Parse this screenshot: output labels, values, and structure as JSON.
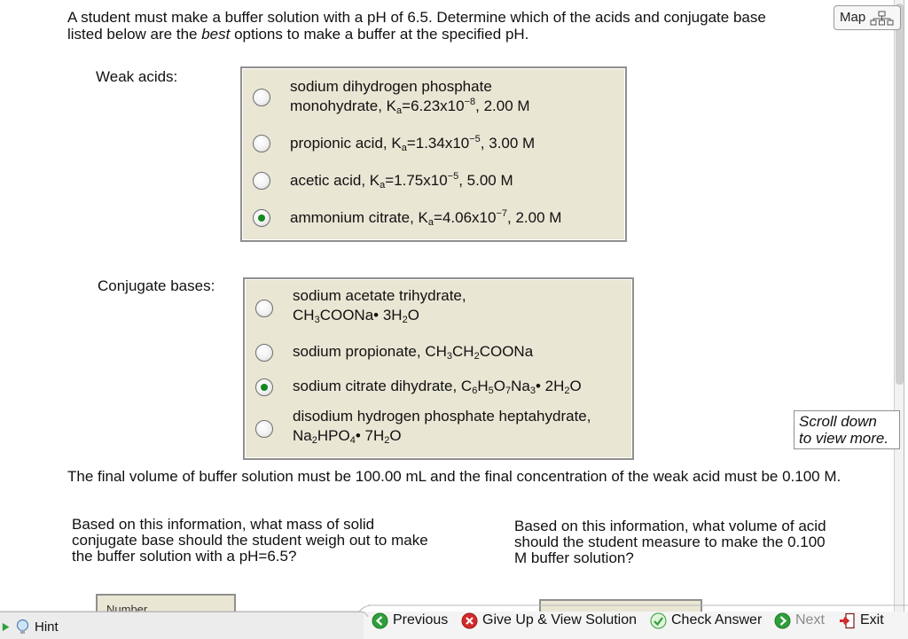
{
  "question": {
    "intro_part1": "A student must make a buffer solution with a pH of 6.5. Determine which of the acids and conjugate base",
    "intro_part2": "listed below are the ",
    "intro_emphasis": "best",
    "intro_part3": " options to make a buffer at the specified pH."
  },
  "map_button": {
    "label": "Map",
    "icon": "map-network-icon"
  },
  "weak_acids": {
    "label": "Weak acids:",
    "options": [
      {
        "line1": "sodium dihydrogen phosphate",
        "line2_pre": "monohydrate, K",
        "sub": "a",
        "eq": "=6.23x10",
        "sup": "−8",
        "post": ", 2.00 M",
        "selected": false
      },
      {
        "pre": "propionic acid, K",
        "sub": "a",
        "eq": "=1.34x10",
        "sup": "−5",
        "post": ", 3.00 M",
        "selected": false
      },
      {
        "pre": "acetic acid, K",
        "sub": "a",
        "eq": "=1.75x10",
        "sup": "−5",
        "post": ", 5.00 M",
        "selected": false
      },
      {
        "pre": "ammonium citrate, K",
        "sub": "a",
        "eq": "=4.06x10",
        "sup": "−7",
        "post": ", 2.00 M",
        "selected": true
      }
    ]
  },
  "conjugate_bases": {
    "label": "Conjugate bases:",
    "options": [
      {
        "line1": "sodium acetate trihydrate,",
        "f": [
          "CH",
          "3",
          "COONa• 3H",
          "2",
          "O"
        ],
        "selected": false
      },
      {
        "f": [
          "sodium propionate, CH",
          "3",
          "CH",
          "2",
          "COONa"
        ],
        "selected": false
      },
      {
        "f": [
          "sodium citrate dihydrate, C",
          "6",
          "H",
          "5",
          "O",
          "7",
          "Na",
          "3",
          "• 2H",
          "2",
          "O"
        ],
        "selected": true
      },
      {
        "line1": "disodium hydrogen phosphate heptahydrate,",
        "f": [
          "Na",
          "2",
          "HPO",
          "4",
          "• 7H",
          "2",
          "O"
        ],
        "selected": false
      }
    ]
  },
  "scroll_note": {
    "line1": "Scroll down",
    "line2": "to view more."
  },
  "paragraph": "The final volume of buffer solution must be 100.00 mL and the final concentration of the weak acid must be 0.100 M.",
  "subquestion_left": "Based on this information, what mass of solid conjugate base should the student weigh out to make the buffer solution with a pH=6.5?",
  "subquestion_right": "Based on this information, what volume of acid should the student measure to make the 0.100 M buffer solution?",
  "answer_left_placeholder": "Number",
  "toolbar": {
    "hint": "Hint",
    "previous": "Previous",
    "give_up": "Give Up & View Solution",
    "check_answer": "Check Answer",
    "next": "Next",
    "exit": "Exit"
  },
  "colors": {
    "choice_background": "#e9e6d4",
    "selected_radio": "#13881f",
    "toolbar_green": "#2f9e3a",
    "give_up_red": "#d22a2a",
    "exit_red": "#d22a2a"
  }
}
